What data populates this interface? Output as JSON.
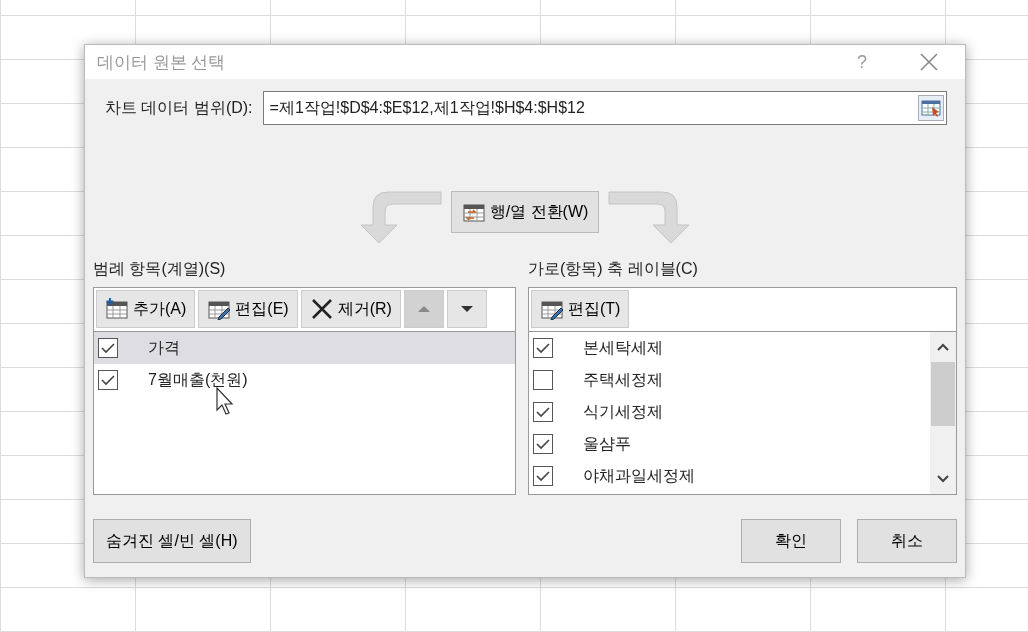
{
  "window": {
    "title": "데이터 원본 선택",
    "help": "?"
  },
  "range": {
    "label": "차트 데이터 범위(D):",
    "value": "=제1작업!$D$4:$E$12,제1작업!$H$4:$H$12"
  },
  "switch_button": "행/열 전환(W)",
  "legend": {
    "label": "범례 항목(계열)(S)",
    "buttons": [
      {
        "label": "추가(A)",
        "kind": "add",
        "disabled": false
      },
      {
        "label": "편집(E)",
        "kind": "edit",
        "disabled": false
      },
      {
        "label": "제거(R)",
        "kind": "remove",
        "disabled": false
      },
      {
        "kind": "up",
        "disabled": true
      },
      {
        "kind": "down",
        "disabled": false
      }
    ],
    "items": [
      {
        "label": "가격",
        "checked": true,
        "selected": true
      },
      {
        "label": "7월매출(천원)",
        "checked": true,
        "selected": false
      }
    ]
  },
  "axis": {
    "label": "가로(항목) 축 레이블(C)",
    "buttons": [
      {
        "label": "편집(T)",
        "kind": "edit",
        "disabled": false
      }
    ],
    "items": [
      {
        "label": "본세탁세제",
        "checked": true,
        "selected": false
      },
      {
        "label": "주택세정제",
        "checked": false,
        "selected": false
      },
      {
        "label": "식기세정제",
        "checked": true,
        "selected": false
      },
      {
        "label": "울샴푸",
        "checked": true,
        "selected": false
      },
      {
        "label": "야채과일세정제",
        "checked": true,
        "selected": false
      }
    ]
  },
  "buttons": [
    {
      "label": "숨겨진 셀/빈 셀(H)"
    },
    {
      "label": "확인"
    },
    {
      "label": "취소"
    }
  ]
}
